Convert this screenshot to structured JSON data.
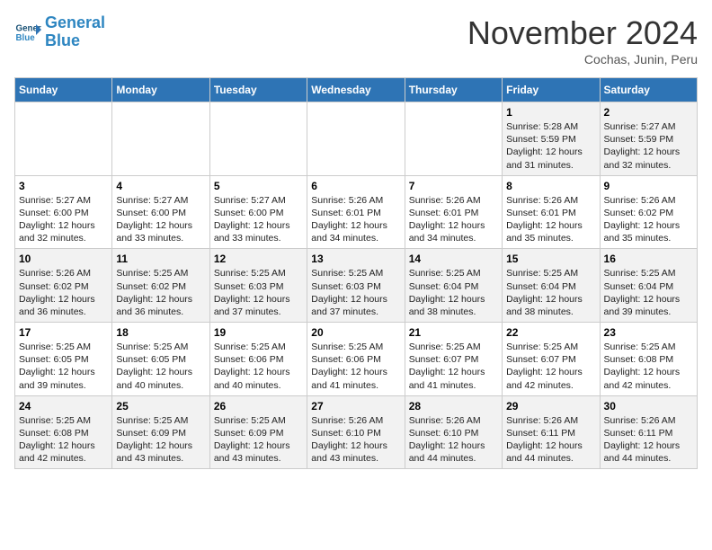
{
  "header": {
    "logo_line1": "General",
    "logo_line2": "Blue",
    "month_title": "November 2024",
    "location": "Cochas, Junin, Peru"
  },
  "weekdays": [
    "Sunday",
    "Monday",
    "Tuesday",
    "Wednesday",
    "Thursday",
    "Friday",
    "Saturday"
  ],
  "weeks": [
    [
      {
        "day": "",
        "info": ""
      },
      {
        "day": "",
        "info": ""
      },
      {
        "day": "",
        "info": ""
      },
      {
        "day": "",
        "info": ""
      },
      {
        "day": "",
        "info": ""
      },
      {
        "day": "1",
        "info": "Sunrise: 5:28 AM\nSunset: 5:59 PM\nDaylight: 12 hours and 31 minutes."
      },
      {
        "day": "2",
        "info": "Sunrise: 5:27 AM\nSunset: 5:59 PM\nDaylight: 12 hours and 32 minutes."
      }
    ],
    [
      {
        "day": "3",
        "info": "Sunrise: 5:27 AM\nSunset: 6:00 PM\nDaylight: 12 hours and 32 minutes."
      },
      {
        "day": "4",
        "info": "Sunrise: 5:27 AM\nSunset: 6:00 PM\nDaylight: 12 hours and 33 minutes."
      },
      {
        "day": "5",
        "info": "Sunrise: 5:27 AM\nSunset: 6:00 PM\nDaylight: 12 hours and 33 minutes."
      },
      {
        "day": "6",
        "info": "Sunrise: 5:26 AM\nSunset: 6:01 PM\nDaylight: 12 hours and 34 minutes."
      },
      {
        "day": "7",
        "info": "Sunrise: 5:26 AM\nSunset: 6:01 PM\nDaylight: 12 hours and 34 minutes."
      },
      {
        "day": "8",
        "info": "Sunrise: 5:26 AM\nSunset: 6:01 PM\nDaylight: 12 hours and 35 minutes."
      },
      {
        "day": "9",
        "info": "Sunrise: 5:26 AM\nSunset: 6:02 PM\nDaylight: 12 hours and 35 minutes."
      }
    ],
    [
      {
        "day": "10",
        "info": "Sunrise: 5:26 AM\nSunset: 6:02 PM\nDaylight: 12 hours and 36 minutes."
      },
      {
        "day": "11",
        "info": "Sunrise: 5:25 AM\nSunset: 6:02 PM\nDaylight: 12 hours and 36 minutes."
      },
      {
        "day": "12",
        "info": "Sunrise: 5:25 AM\nSunset: 6:03 PM\nDaylight: 12 hours and 37 minutes."
      },
      {
        "day": "13",
        "info": "Sunrise: 5:25 AM\nSunset: 6:03 PM\nDaylight: 12 hours and 37 minutes."
      },
      {
        "day": "14",
        "info": "Sunrise: 5:25 AM\nSunset: 6:04 PM\nDaylight: 12 hours and 38 minutes."
      },
      {
        "day": "15",
        "info": "Sunrise: 5:25 AM\nSunset: 6:04 PM\nDaylight: 12 hours and 38 minutes."
      },
      {
        "day": "16",
        "info": "Sunrise: 5:25 AM\nSunset: 6:04 PM\nDaylight: 12 hours and 39 minutes."
      }
    ],
    [
      {
        "day": "17",
        "info": "Sunrise: 5:25 AM\nSunset: 6:05 PM\nDaylight: 12 hours and 39 minutes."
      },
      {
        "day": "18",
        "info": "Sunrise: 5:25 AM\nSunset: 6:05 PM\nDaylight: 12 hours and 40 minutes."
      },
      {
        "day": "19",
        "info": "Sunrise: 5:25 AM\nSunset: 6:06 PM\nDaylight: 12 hours and 40 minutes."
      },
      {
        "day": "20",
        "info": "Sunrise: 5:25 AM\nSunset: 6:06 PM\nDaylight: 12 hours and 41 minutes."
      },
      {
        "day": "21",
        "info": "Sunrise: 5:25 AM\nSunset: 6:07 PM\nDaylight: 12 hours and 41 minutes."
      },
      {
        "day": "22",
        "info": "Sunrise: 5:25 AM\nSunset: 6:07 PM\nDaylight: 12 hours and 42 minutes."
      },
      {
        "day": "23",
        "info": "Sunrise: 5:25 AM\nSunset: 6:08 PM\nDaylight: 12 hours and 42 minutes."
      }
    ],
    [
      {
        "day": "24",
        "info": "Sunrise: 5:25 AM\nSunset: 6:08 PM\nDaylight: 12 hours and 42 minutes."
      },
      {
        "day": "25",
        "info": "Sunrise: 5:25 AM\nSunset: 6:09 PM\nDaylight: 12 hours and 43 minutes."
      },
      {
        "day": "26",
        "info": "Sunrise: 5:25 AM\nSunset: 6:09 PM\nDaylight: 12 hours and 43 minutes."
      },
      {
        "day": "27",
        "info": "Sunrise: 5:26 AM\nSunset: 6:10 PM\nDaylight: 12 hours and 43 minutes."
      },
      {
        "day": "28",
        "info": "Sunrise: 5:26 AM\nSunset: 6:10 PM\nDaylight: 12 hours and 44 minutes."
      },
      {
        "day": "29",
        "info": "Sunrise: 5:26 AM\nSunset: 6:11 PM\nDaylight: 12 hours and 44 minutes."
      },
      {
        "day": "30",
        "info": "Sunrise: 5:26 AM\nSunset: 6:11 PM\nDaylight: 12 hours and 44 minutes."
      }
    ]
  ]
}
